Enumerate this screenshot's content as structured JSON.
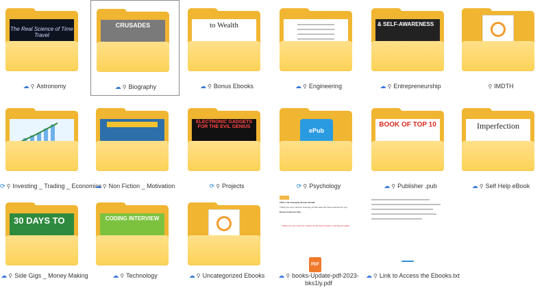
{
  "folders": [
    {
      "label": "Astronomy",
      "icon": "cloud",
      "owner": "person",
      "cover": "The Real Science of Time Travel"
    },
    {
      "label": "Biography",
      "icon": "cloud",
      "owner": "person",
      "cover": "CRUSADES"
    },
    {
      "label": "Bonus Ebooks",
      "icon": "cloud",
      "owner": "person",
      "cover": "to Wealth"
    },
    {
      "label": "Engineering",
      "icon": "cloud",
      "owner": "person",
      "cover": ""
    },
    {
      "label": "Entrepreneurship",
      "icon": "cloud",
      "owner": "person",
      "cover": "& SELF-AWARENESS"
    },
    {
      "label": "IMDTH",
      "icon": "cloud",
      "owner": "person",
      "cover": ""
    },
    {
      "label": "Investing _ Trading _ Economics",
      "icon": "sync",
      "owner": "person",
      "cover": ""
    },
    {
      "label": "Non Fiction _ Motivation",
      "icon": "cloud",
      "owner": "person",
      "cover": ""
    },
    {
      "label": "Projects",
      "icon": "sync",
      "owner": "person",
      "cover": "ELECTRONIC GADGETS FOR THE EVIL GENIUS"
    },
    {
      "label": "Psychology",
      "icon": "sync",
      "owner": "person",
      "cover": "ePub"
    },
    {
      "label": "Publisher .pub",
      "icon": "cloud",
      "owner": "person",
      "cover": "BOOK OF TOP 10"
    },
    {
      "label": "Self Help eBook",
      "icon": "cloud",
      "owner": "person",
      "cover": "Imperfection"
    },
    {
      "label": "Side Gigs _ Money Making",
      "icon": "cloud",
      "owner": "person",
      "cover": "30 DAYS TO"
    },
    {
      "label": "Technology",
      "icon": "cloud",
      "owner": "person",
      "cover": "CODING INTERVIEW"
    },
    {
      "label": "Uncategorized Ebooks",
      "icon": "cloud",
      "owner": "person",
      "cover": ""
    }
  ],
  "files": [
    {
      "label": "books-Update-pdf-2023-bks1ly.pdf",
      "icon": "cloud",
      "owner": "person",
      "type": "PDF"
    },
    {
      "label": "Link to Access the Ebooks.txt",
      "icon": "cloud",
      "owner": "person",
      "type": "TXT"
    }
  ],
  "doc_preview": {
    "pdf_title": "1000+ Life Changing Ebooks Bundle",
    "pdf_line": "Thank you very much for choosing us! We have the best resources for you.",
    "pdf_label": "Ebook Collection Site:",
    "pdf_footer": "Thank you very much for trusting us! We look forward to serving you again."
  },
  "colors": {
    "folder_back": "#f0b531",
    "folder_front": "#fcd257",
    "sync": "#1e7fd6",
    "cloud": "#3b7ad8"
  }
}
